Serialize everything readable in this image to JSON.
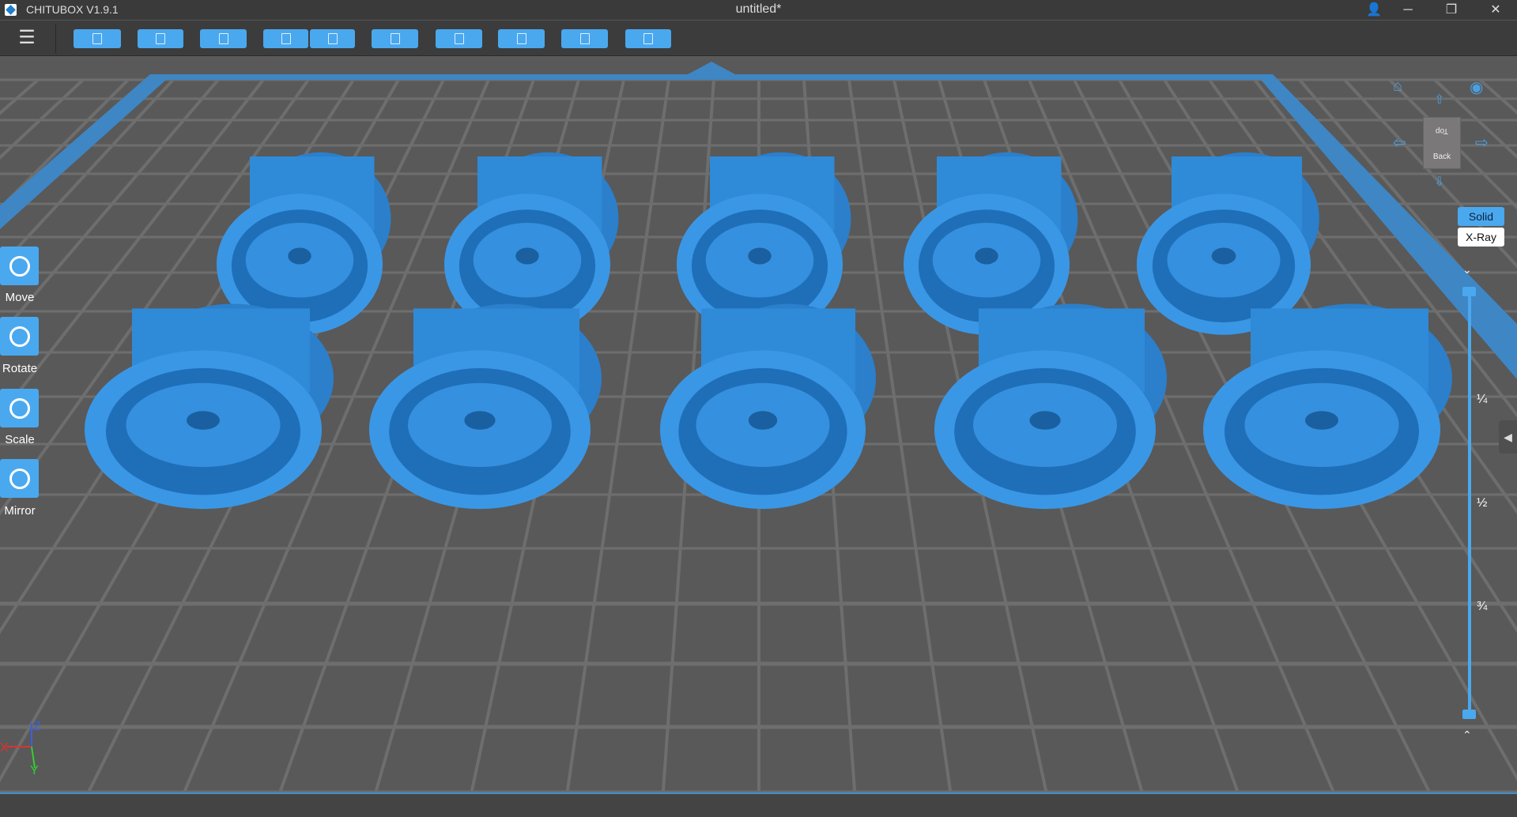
{
  "window": {
    "app_name": "CHITUBOX V1.9.1",
    "title": "untitled*",
    "controls": {
      "account": "👤",
      "minimize": "─",
      "restore": "❐",
      "close": "✕"
    }
  },
  "toolbar": {
    "menu": "☰",
    "buttons": [
      "open",
      "save",
      "auto-layout",
      "undo",
      "redo",
      "settings",
      "slice-preview",
      "supports",
      "hollow",
      "drill"
    ]
  },
  "left_tools": [
    {
      "id": "move",
      "label": "Move"
    },
    {
      "id": "rotate",
      "label": "Rotate"
    },
    {
      "id": "scale",
      "label": "Scale"
    },
    {
      "id": "mirror",
      "label": "Mirror"
    }
  ],
  "view": {
    "cube_top": "Top",
    "cube_front": "Back",
    "render_modes": {
      "solid": "Solid",
      "xray": "X-Ray"
    },
    "active_mode": "Solid"
  },
  "layer_slider": {
    "marks": [
      "¼",
      "½",
      "¾"
    ],
    "top_value": 1.0,
    "bottom_value": 0.0
  },
  "axes": {
    "x": "X",
    "y": "Y",
    "z": "Z"
  },
  "colors": {
    "accent": "#4aa8ef",
    "model": "#2f8ad8",
    "bed_frame": "#3f86c4"
  }
}
